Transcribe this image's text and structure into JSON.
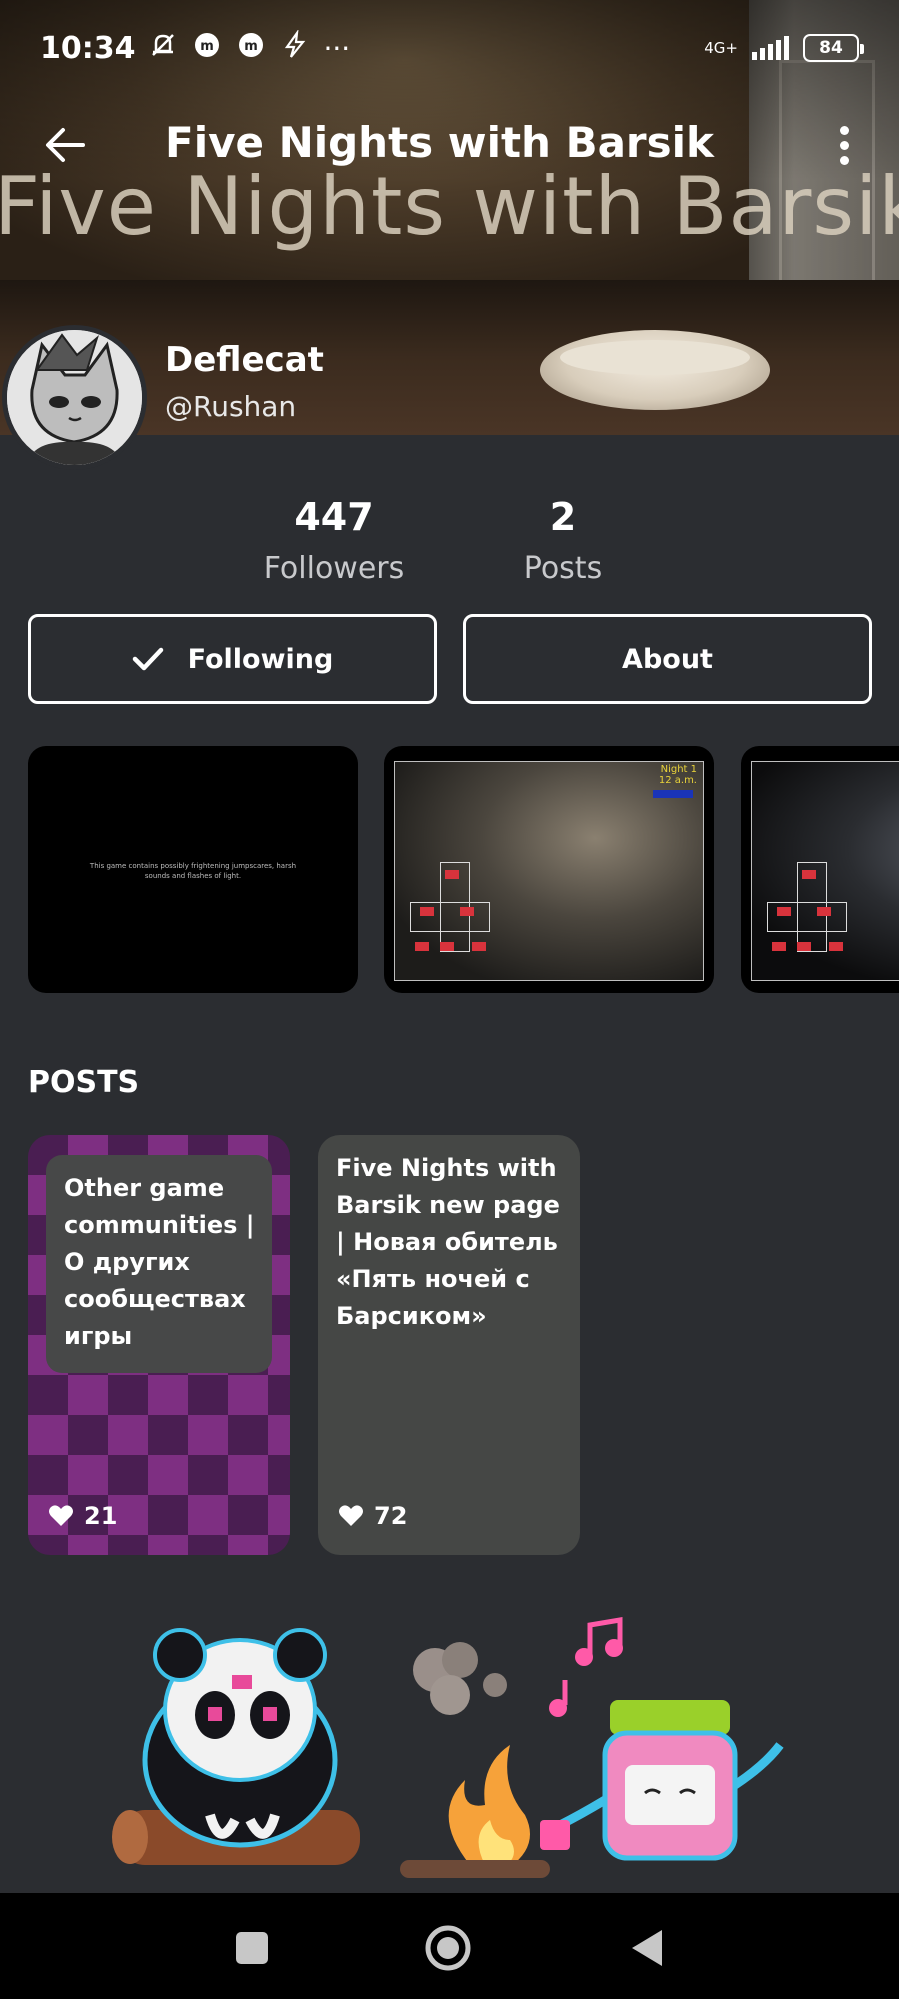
{
  "status_bar": {
    "time": "10:34",
    "network": "4G+",
    "battery": "84",
    "more": "···"
  },
  "header": {
    "title": "Five Nights with Barsik",
    "banner_text": "Five Nights with Barsik"
  },
  "profile": {
    "name": "Deflecat",
    "handle": "@Rushan"
  },
  "stats": [
    {
      "value": "447",
      "label": "Followers"
    },
    {
      "value": "2",
      "label": "Posts"
    }
  ],
  "actions": {
    "following_label": "Following",
    "about_label": "About"
  },
  "gallery": {
    "warning_text": "This game contains possibly frightening jumpscares, harsh sounds and flashes of light.",
    "night_label": "Night 1",
    "time_label": "12 a.m."
  },
  "posts": {
    "section_title": "POSTS",
    "items": [
      {
        "title": "Other game communities | О других сообществах игры",
        "likes": "21"
      },
      {
        "title": "Five Nights with Barsik new page | Новая обитель «Пять ночей с Барсиком»",
        "likes": "72"
      }
    ]
  },
  "colors": {
    "background": "#2b2d31",
    "card": "#454745",
    "accent": "#ffffff"
  }
}
